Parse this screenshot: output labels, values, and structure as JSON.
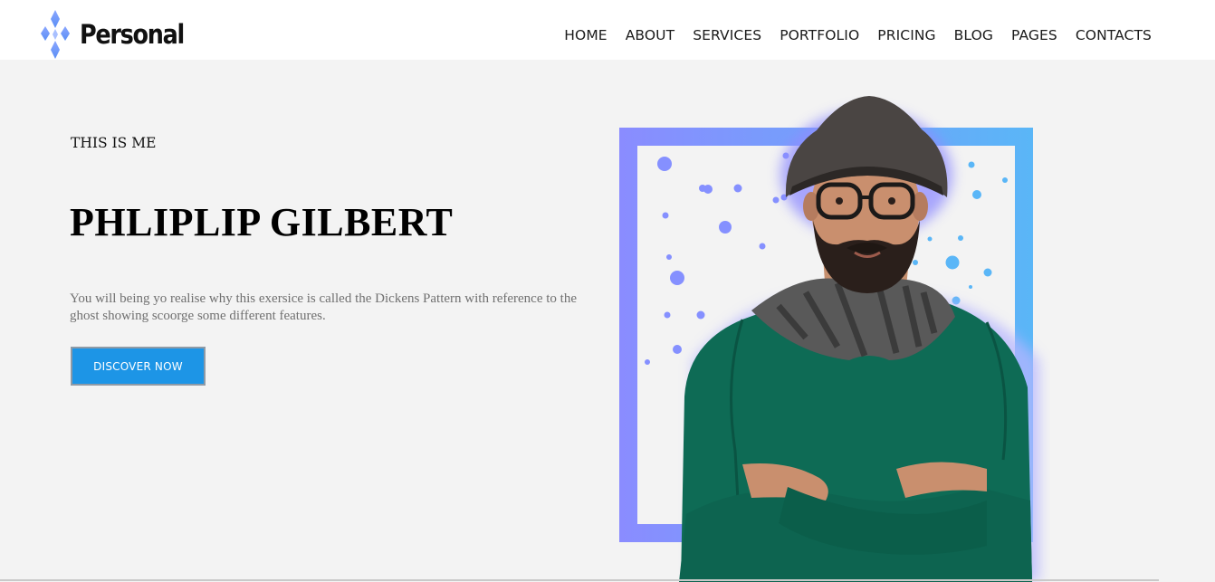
{
  "brand": {
    "name": "Personal",
    "icon": "diamond-cluster-logo-icon",
    "accent_color": "#7ea8ff"
  },
  "nav": {
    "items": [
      {
        "label": "HOME"
      },
      {
        "label": "ABOUT"
      },
      {
        "label": "SERVICES"
      },
      {
        "label": "PORTFOLIO"
      },
      {
        "label": "PRICING"
      },
      {
        "label": "BLOG"
      },
      {
        "label": "PAGES"
      },
      {
        "label": "CONTACTS"
      }
    ]
  },
  "hero": {
    "eyebrow": "THIS IS ME",
    "title": "PHLIPLIP GILBERT",
    "description": "You will being yo realise why this exersice is called the Dickens Pattern with reference to the ghost showing scoorge some different features.",
    "button_label": "DISCOVER NOW",
    "button_color": "#1d95e6",
    "frame_gradient": [
      "#8a8cff",
      "#5ab6f7"
    ],
    "portrait": "bearded-man-with-hat-and-glasses-portrait"
  }
}
